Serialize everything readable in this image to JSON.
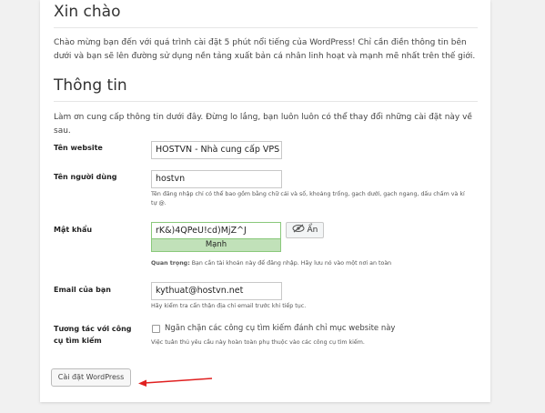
{
  "welcome": {
    "heading": "Xin chào",
    "intro": "Chào mừng bạn đến với quá trình cài đặt 5 phút nổi tiếng của WordPress! Chỉ cần điền thông tin bên dưới và bạn sẽ lên đường sử dụng nền tảng xuất bản cá nhân linh hoạt và mạnh mẽ nhất trên thế giới."
  },
  "info": {
    "heading": "Thông tin",
    "intro": "Làm ơn cung cấp thông tin dưới đây. Đừng lo lắng, bạn luôn luôn có thể thay đổi những cài đặt này về sau."
  },
  "form": {
    "site_title": {
      "label": "Tên website",
      "value": "HOSTVN - Nhà cung cấp VPS H"
    },
    "username": {
      "label": "Tên người dùng",
      "value": "hostvn",
      "hint": "Tên đăng nhập chỉ có thể bao gồm bằng chữ cái và số, khoảng trống, gạch dưới, gạch ngang, dấu chấm và kí tự @."
    },
    "password": {
      "label": "Mật khẩu",
      "value": "rK&)4QPeU!cd)MjZ^J",
      "hide_label": "Ẩn",
      "strength": "Mạnh",
      "note_strong": "Quan trọng:",
      "note": " Bạn cần tài khoản này để đăng nhập. Hãy lưu nó vào một nơi an toàn"
    },
    "email": {
      "label": "Email của bạn",
      "value": "kythuat@hostvn.net",
      "hint": "Hãy kiểm tra cẩn thận địa chỉ email trước khi tiếp tục."
    },
    "search": {
      "label": "Tương tác với công cụ tìm kiếm",
      "checkbox_label": "Ngăn chặn các công cụ tìm kiếm đánh chỉ mục website này",
      "hint": "Việc tuân thủ yêu cầu này hoàn toàn phụ thuộc vào các công cụ tìm kiếm."
    },
    "submit_label": "Cài đặt WordPress"
  },
  "colors": {
    "strength_bg": "#c1e1b9",
    "arrow": "#e02020"
  }
}
